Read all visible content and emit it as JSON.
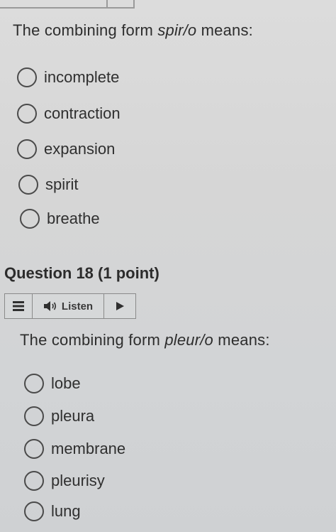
{
  "question17": {
    "prompt_prefix": "The combining form ",
    "prompt_term": "spir/o",
    "prompt_suffix": " means:",
    "options": [
      {
        "label": "incomplete"
      },
      {
        "label": "contraction"
      },
      {
        "label": "expansion"
      },
      {
        "label": "spirit"
      },
      {
        "label": "breathe"
      }
    ]
  },
  "question18": {
    "header": "Question 18 (1 point)",
    "toolbar": {
      "menu_icon": "hamburger-menu-icon",
      "speaker_icon": "speaker-icon",
      "listen_label": "Listen",
      "play_icon": "play-icon"
    },
    "prompt_prefix": "The combining form ",
    "prompt_term": "pleur/o",
    "prompt_suffix": " means:",
    "options": [
      {
        "label": "lobe"
      },
      {
        "label": "pleura"
      },
      {
        "label": "membrane"
      },
      {
        "label": "pleurisy"
      },
      {
        "label": "lung"
      }
    ]
  },
  "colors": {
    "background": "#d6d6d6",
    "text": "#2f2f2f",
    "border": "#8a8a8a"
  }
}
